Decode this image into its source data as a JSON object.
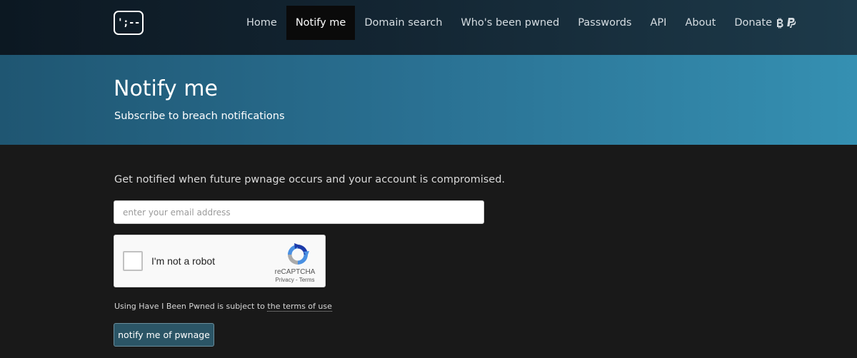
{
  "header": {
    "logo_text": "';--",
    "nav_items": [
      {
        "label": "Home",
        "active": false
      },
      {
        "label": "Notify me",
        "active": true
      },
      {
        "label": "Domain search",
        "active": false
      },
      {
        "label": "Who's been pwned",
        "active": false
      },
      {
        "label": "Passwords",
        "active": false
      },
      {
        "label": "API",
        "active": false
      },
      {
        "label": "About",
        "active": false
      },
      {
        "label": "Donate",
        "active": false,
        "icons": [
          "bitcoin-icon",
          "paypal-icon"
        ]
      }
    ]
  },
  "hero": {
    "title": "Notify me",
    "subtitle": "Subscribe to breach notifications"
  },
  "main": {
    "intro": "Get notified when future pwnage occurs and your account is compromised.",
    "email": {
      "placeholder": "enter your email address",
      "value": ""
    },
    "recaptcha": {
      "label": "I'm not a robot",
      "brand": "reCAPTCHA",
      "privacy": "Privacy",
      "separator": " - ",
      "terms": "Terms"
    },
    "terms_prefix": "Using Have I Been Pwned is subject to ",
    "terms_link": "the terms of use",
    "submit_label": "notify me of pwnage"
  },
  "colors": {
    "accent": "#2b5566",
    "hero_gradient_start": "#1f5672",
    "hero_gradient_end": "#3590b2",
    "background": "#191919"
  }
}
